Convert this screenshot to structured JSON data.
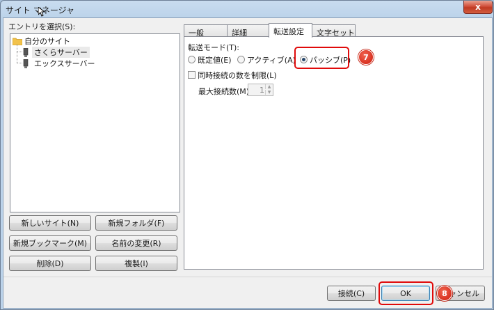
{
  "window": {
    "title": "サイト マネージャ",
    "close_glyph": "x"
  },
  "left": {
    "entry_label": "エントリを選択(S):",
    "tree": {
      "root_label": "自分のサイト",
      "children": [
        "さくらサーバー",
        "エックスサーバー"
      ]
    },
    "buttons": {
      "new_site": "新しいサイト(N)",
      "new_folder": "新規フォルダ(F)",
      "new_bookmark": "新規ブックマーク(M)",
      "rename": "名前の変更(R)",
      "delete": "削除(D)",
      "duplicate": "複製(I)"
    }
  },
  "tabs": [
    {
      "label": "一般",
      "active": false
    },
    {
      "label": "詳細",
      "active": false
    },
    {
      "label": "転送設定",
      "active": true
    },
    {
      "label": "文字セット",
      "active": false
    }
  ],
  "transfer": {
    "mode_label": "転送モード(T):",
    "options": [
      {
        "label": "既定値(E)",
        "selected": false
      },
      {
        "label": "アクティブ(A)",
        "selected": false
      },
      {
        "label": "パッシブ(P)",
        "selected": true
      }
    ],
    "limit_label": "同時接続の数を制限(L)",
    "limit_checked": false,
    "max_label": "最大接続数(M):",
    "max_value": "1"
  },
  "footer": {
    "connect": "接続(C)",
    "ok": "OK",
    "cancel": "キャンセル"
  },
  "annotations": {
    "step7": "7",
    "step8": "8",
    "highlight_color": "#e00a0a"
  }
}
